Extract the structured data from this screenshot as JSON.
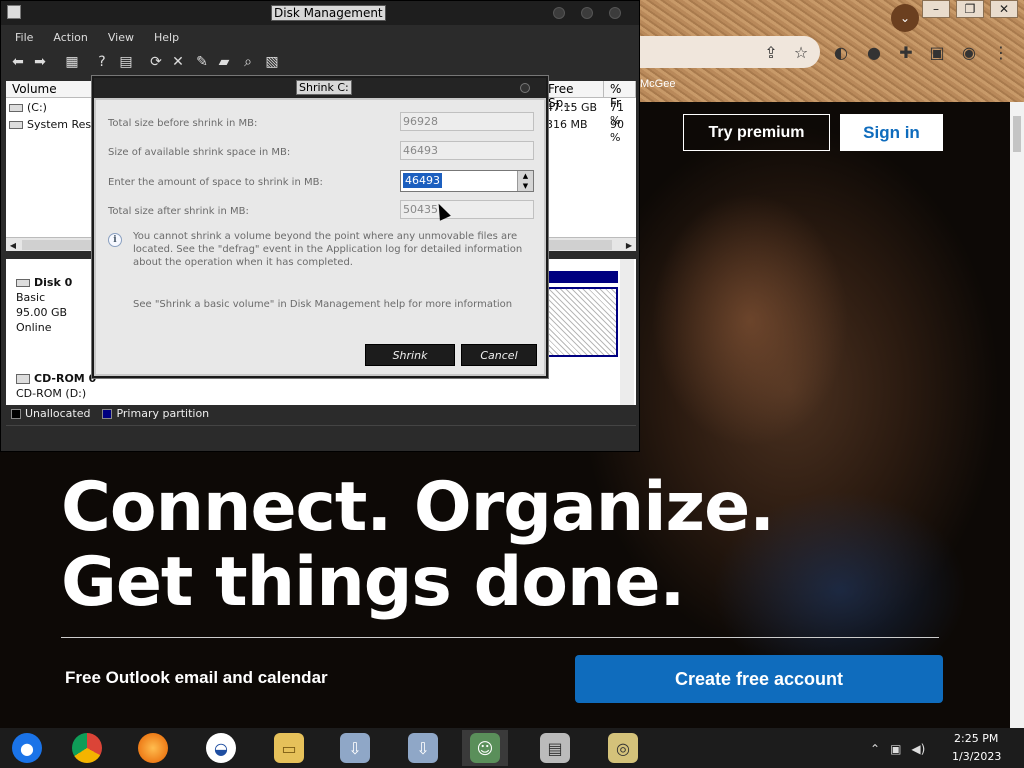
{
  "browser": {
    "bookmark_text": "McGee",
    "try_premium": "Try premium",
    "sign_in": "Sign in",
    "hero_line1": "Connect. Organize.",
    "hero_line2": "Get things done.",
    "free_outlook": "Free Outlook email and calendar",
    "create_account": "Create free account",
    "window_controls": [
      "–",
      "❐",
      "✕"
    ]
  },
  "disk_management": {
    "title": "Disk Management",
    "menu": [
      "File",
      "Action",
      "View",
      "Help"
    ],
    "columns": [
      "Volume",
      "Free Sp...",
      "% Fr"
    ],
    "volumes": [
      {
        "name": "(C:)",
        "free": "47.15 GB",
        "pct": "71 %"
      },
      {
        "name": "System Rese",
        "free": "316 MB",
        "pct": "90 %"
      }
    ],
    "disks": [
      {
        "name": "Disk 0",
        "type": "Basic",
        "size": "95.00 GB",
        "status": "Online"
      },
      {
        "name": "CD-ROM 0",
        "type": "CD-ROM (D:)"
      }
    ],
    "legend": [
      {
        "label": "Unallocated",
        "color": "#000000"
      },
      {
        "label": "Primary partition",
        "color": "#000080"
      }
    ]
  },
  "shrink_dialog": {
    "title": "Shrink C:",
    "fields": [
      {
        "label": "Total size before shrink in MB:",
        "value": "96928"
      },
      {
        "label": "Size of available shrink space in MB:",
        "value": "46493"
      },
      {
        "label": "Enter the amount of space to shrink in MB:",
        "value": "46493"
      },
      {
        "label": "Total size after shrink in MB:",
        "value": "50435"
      }
    ],
    "info": "You cannot shrink a volume beyond the point where any unmovable files are located. See the \"defrag\" event in the Application log for detailed information about the operation when it has completed.",
    "help": "See \"Shrink a basic volume\" in Disk Management help for more information",
    "shrink_button": "Shrink",
    "cancel_button": "Cancel"
  },
  "taskbar": {
    "apps": [
      "chromium",
      "chrome",
      "firefox",
      "obama-campaign",
      "file-explorer",
      "network-setup",
      "network-setup-2",
      "people",
      "disk-management",
      "hard-drive"
    ],
    "time": "2:25 PM",
    "date": "1/3/2023"
  },
  "colors": {
    "accent": "#0f6cbd",
    "selection": "#1c5fbf",
    "primary_partition": "#000080"
  }
}
